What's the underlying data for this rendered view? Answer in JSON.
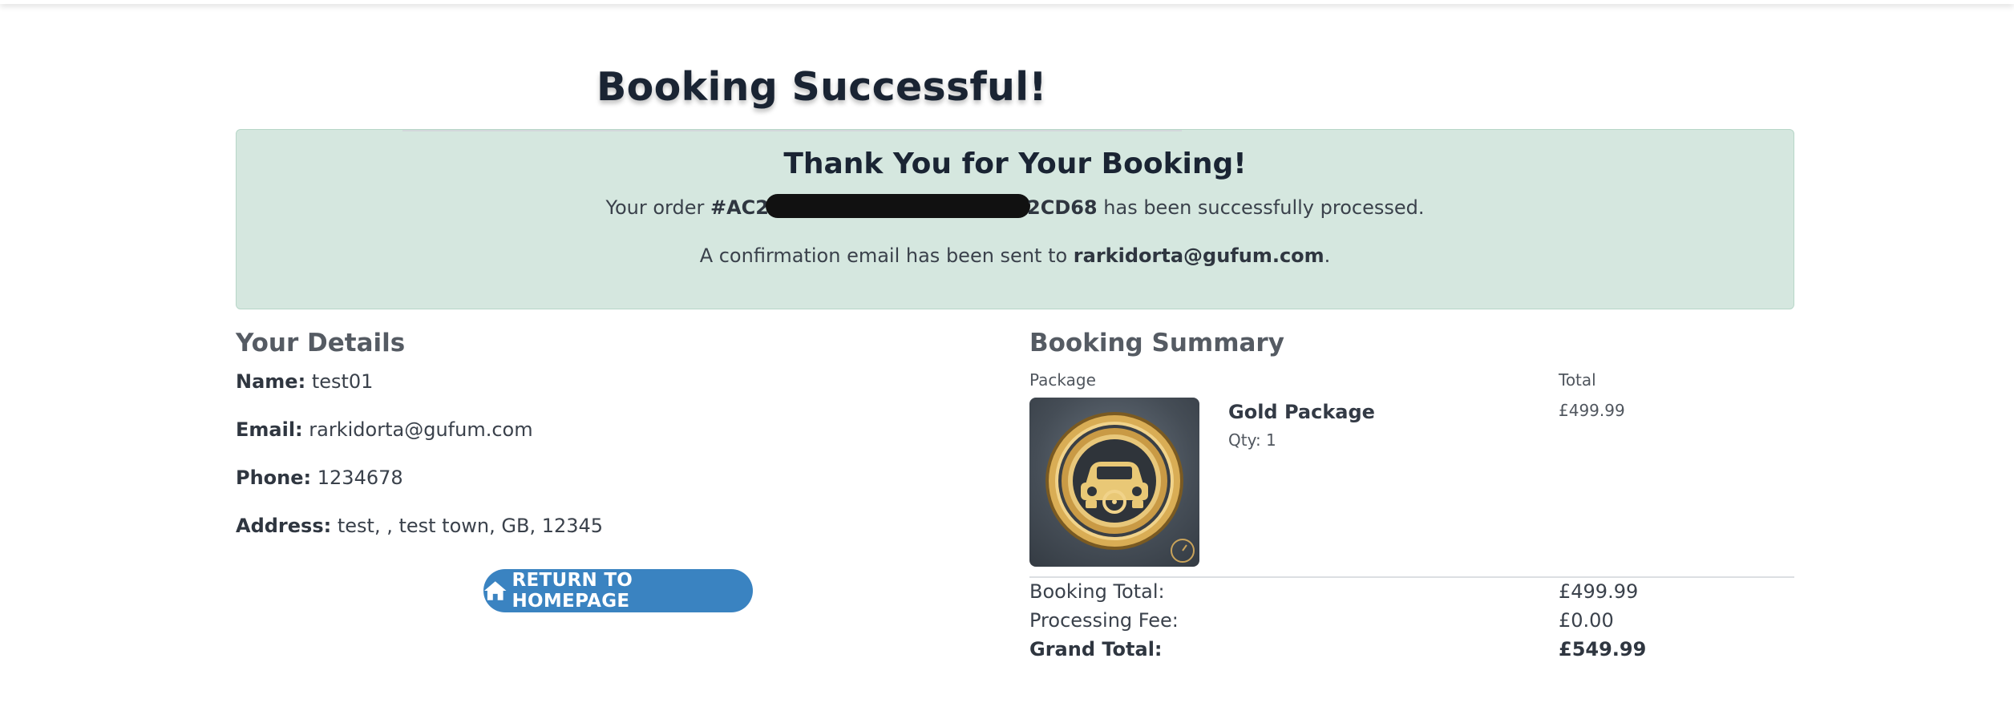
{
  "page": {
    "title": "Booking Successful!"
  },
  "confirmation": {
    "heading": "Thank You for Your Booking!",
    "order_prefix": "Your order ",
    "order_id_start": "#AC2",
    "order_id_end": "2CD68",
    "order_suffix": " has been successfully processed.",
    "email_prefix": "A confirmation email has been sent to ",
    "email": "rarkidorta@gufum.com",
    "email_suffix": "."
  },
  "details": {
    "heading": "Your Details",
    "name_label": "Name:",
    "name_value": "test01",
    "email_label": "Email:",
    "email_value": "rarkidorta@gufum.com",
    "phone_label": "Phone:",
    "phone_value": "1234678",
    "address_label": "Address:",
    "address_value": "test, , test town, GB, 12345",
    "return_button": "RETURN TO HOMEPAGE"
  },
  "summary": {
    "heading": "Booking Summary",
    "col_package": "Package",
    "col_total": "Total",
    "package_name": "Gold Package",
    "package_qty": "Qty: 1",
    "package_total": "£499.99",
    "booking_total_label": "Booking Total:",
    "booking_total_value": "£499.99",
    "processing_fee_label": "Processing Fee:",
    "processing_fee_value": "£0.00",
    "grand_total_label": "Grand Total:",
    "grand_total_value": "£549.99"
  },
  "icons": {
    "home": "home-icon",
    "package_image": "gold-car-medal-icon"
  },
  "colors": {
    "success_bg": "#d5e7df",
    "button_bg": "#3a83c1",
    "heading": "#1a2433"
  }
}
